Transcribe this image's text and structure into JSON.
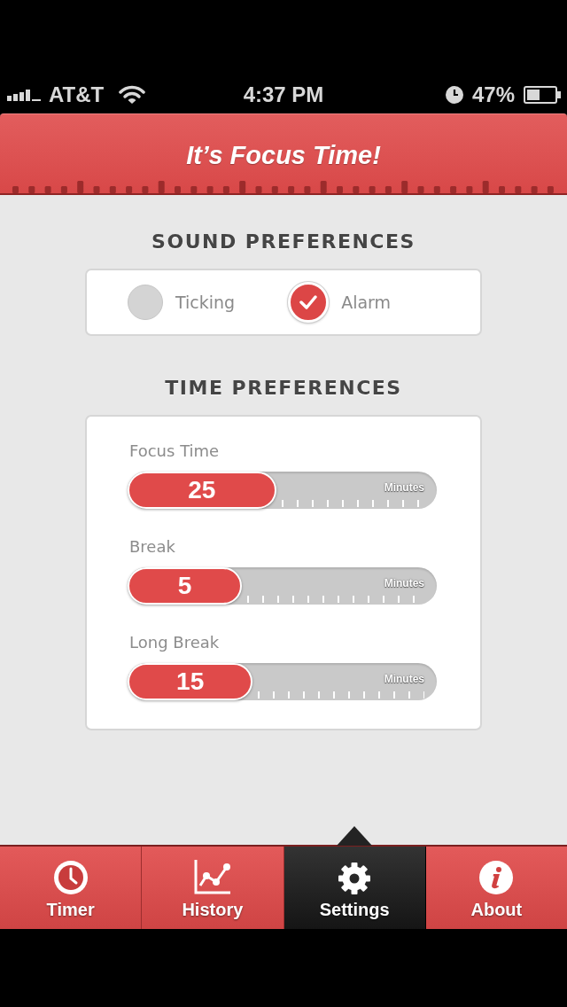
{
  "status_bar": {
    "carrier": "AT&T",
    "time": "4:37 PM",
    "battery": "47%"
  },
  "header": {
    "title": "It’s Focus Time!"
  },
  "sound_preferences": {
    "title": "SOUND PREFERENCES",
    "options": [
      {
        "label": "Ticking",
        "checked": false
      },
      {
        "label": "Alarm",
        "checked": true
      }
    ]
  },
  "time_preferences": {
    "title": "TIME PREFERENCES",
    "sliders": [
      {
        "label": "Focus Time",
        "value": "25",
        "unit": "Minutes",
        "level": 0.48
      },
      {
        "label": "Break",
        "value": "5",
        "unit": "Minutes",
        "level": 0.37
      },
      {
        "label": "Long Break",
        "value": "15",
        "unit": "Minutes",
        "level": 0.405
      }
    ]
  },
  "tabs": [
    {
      "label": "Timer",
      "selected": false
    },
    {
      "label": "History",
      "selected": false
    },
    {
      "label": "Settings",
      "selected": true
    },
    {
      "label": "About",
      "selected": false
    }
  ]
}
